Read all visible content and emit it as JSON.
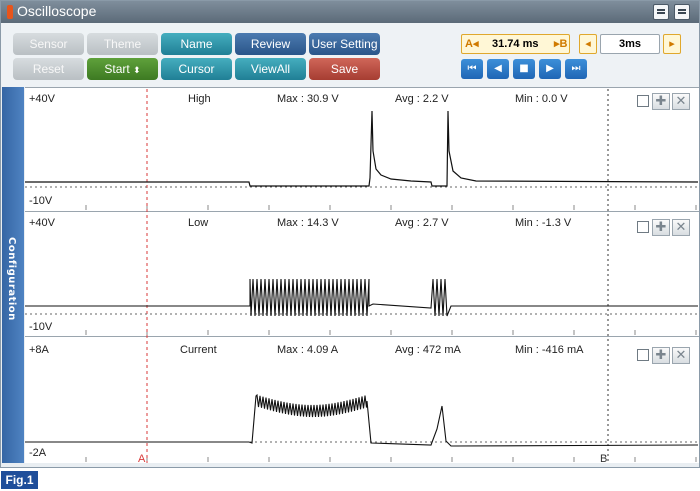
{
  "window": {
    "title": "Oscilloscope"
  },
  "toolbar": {
    "sensor": "Sensor",
    "theme": "Theme",
    "name": "Name",
    "review": "Review",
    "user_setting": "User Setting",
    "reset": "Reset",
    "start": "Start",
    "cursor": "Cursor",
    "view_all": "ViewAll",
    "save": "Save"
  },
  "timebase": {
    "position": "31.74 ms",
    "a_marker": "A",
    "b_marker": "B",
    "div": "3ms"
  },
  "channels": [
    {
      "top": "+40V",
      "bottom": "-10V",
      "name": "High",
      "max": "Max : 30.9 V",
      "avg": "Avg : 2.2 V",
      "min": "Min : 0.0 V"
    },
    {
      "top": "+40V",
      "bottom": "-10V",
      "name": "Low",
      "max": "Max : 14.3 V",
      "avg": "Avg : 2.7 V",
      "min": "Min : -1.3 V"
    },
    {
      "top": "+8A",
      "bottom": "-2A",
      "name": "Current",
      "max": "Max : 4.09 A",
      "avg": "Avg : 472 mA",
      "min": "Min : -416 mA"
    }
  ],
  "side_tab": "Configuration",
  "cursors": {
    "a": "A",
    "b": "B"
  },
  "figure_label": "Fig.1",
  "colors": {
    "teal": "#2a8fa6",
    "navy": "#2f5b8f",
    "green": "#4a8a2c",
    "red": "#b9473b",
    "cursor_a": "#d93a3a",
    "trace": "#111111"
  }
}
